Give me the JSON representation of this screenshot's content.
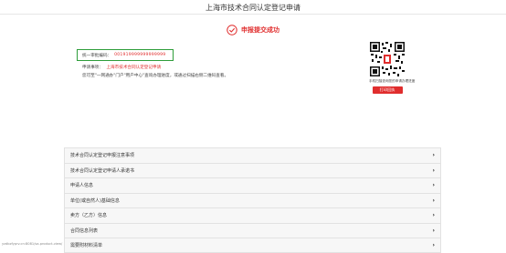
{
  "header": {
    "title": "上海市技术合同认定登记申请"
  },
  "success": {
    "text": "申报提交成功",
    "color": "#e02d2d"
  },
  "info": {
    "code_label": "统一审批编码：",
    "code_value": "001919999999999999",
    "matter_label": "申请事项：",
    "matter_value": "上海市技术合同认定登记申请",
    "hint": "您可至\"一网通办\"门户\"用户中心\"查询办理进度，或通过扫描右侧二维码查看。"
  },
  "qr": {
    "caption": "手机扫描查询您的申请办理进度",
    "button_label": "打印回执"
  },
  "accordion": [
    {
      "label": "技术合同认定登记申报注意事项"
    },
    {
      "label": "技术合同认定登记申请人承诺书"
    },
    {
      "label": "申请人信息"
    },
    {
      "label": "单位(或自然人)基础信息"
    },
    {
      "label": "卖方（乙方）信息"
    },
    {
      "label": "合同信息列表"
    },
    {
      "label": "需要附材料清单"
    }
  ],
  "status_bar": {
    "url": "yzdbzfyprv.cn:8081/sa-product-view/"
  },
  "colors": {
    "accent": "#e02d2d",
    "code_border": "#2e9d3a"
  }
}
